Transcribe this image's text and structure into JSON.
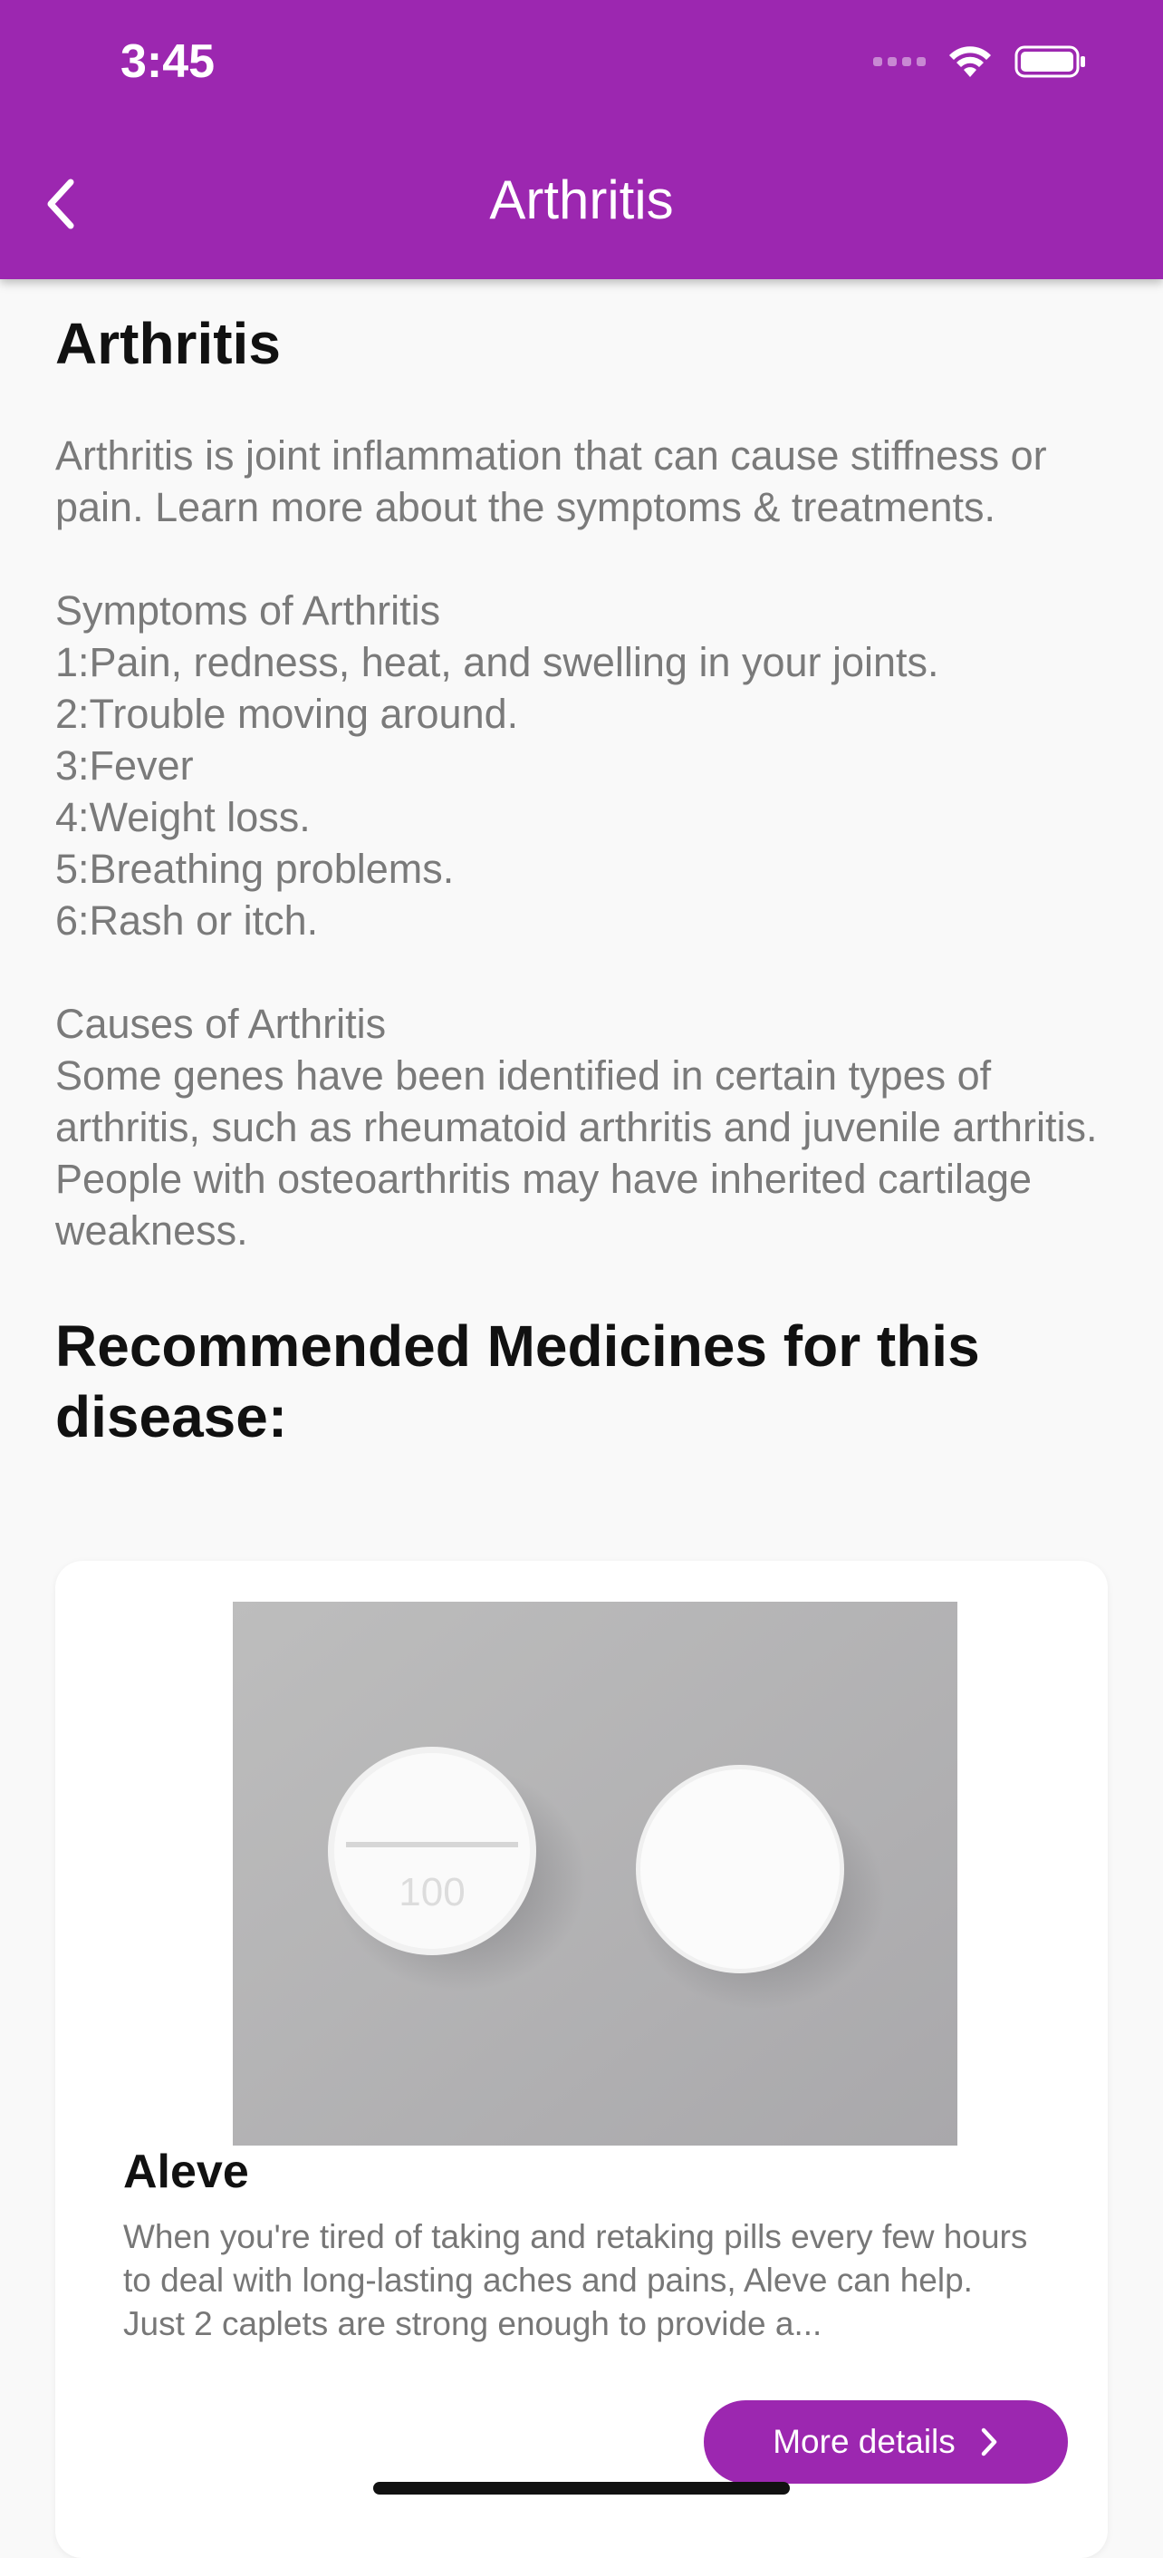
{
  "status_bar": {
    "time": "3:45"
  },
  "app_bar": {
    "title": "Arthritis",
    "back_icon": "chevron-left-icon"
  },
  "page": {
    "heading": "Arthritis",
    "description": "Arthritis is joint inflammation that can cause stiffness or pain. Learn more about the symptoms & treatments.\n\nSymptoms of Arthritis\n1:Pain, redness, heat, and swelling in your joints.\n2:Trouble moving around.\n3:Fever\n4:Weight loss.\n5:Breathing problems.\n6:Rash or itch.\n\nCauses of Arthritis\nSome genes have been identified in certain types of arthritis, such as rheumatoid arthritis and juvenile arthritis. People with osteoarthritis may have inherited cartilage weakness.",
    "recommended_heading": "Recommended Medicines for this disease:"
  },
  "medicine": {
    "name": "Aleve",
    "description": "When you're tired of taking and retaking pills every few hours to deal with long-lasting aches and pains, Aleve can help. Just 2 caplets are strong enough to provide a...",
    "button_label": "More details",
    "pill_imprint": "100"
  },
  "colors": {
    "accent": "#9c27b0",
    "background": "#f9f9f9"
  }
}
